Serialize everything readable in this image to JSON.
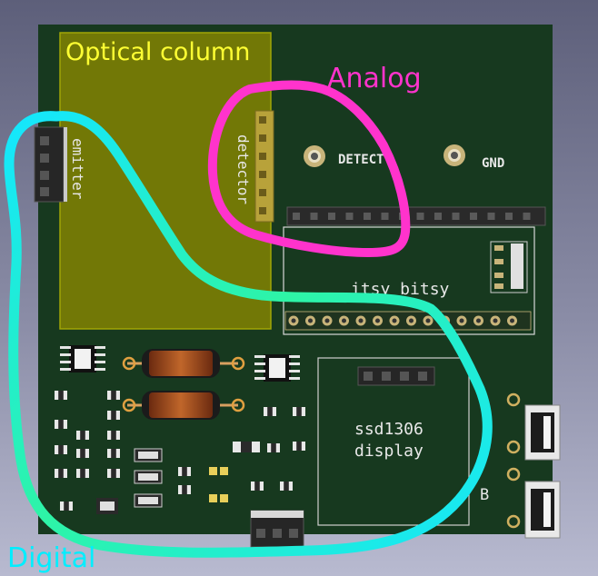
{
  "annotations": {
    "optical_column": "Optical column",
    "analog": "Analog",
    "digital": "Digital"
  },
  "silkscreen": {
    "emitter": "emitter",
    "detector": "detector",
    "detect_pad": "DETECT",
    "gnd_pad": "GND",
    "itsy_bitsy": "itsy bitsy",
    "display_line1": "ssd1306",
    "display_line2": "display",
    "corner_b": "B"
  },
  "colors": {
    "board": "#17391f",
    "optical_highlight": "#8c8a00",
    "optical_label": "#ffff33",
    "analog": "#ff33cc",
    "digital": "#00eeff"
  }
}
